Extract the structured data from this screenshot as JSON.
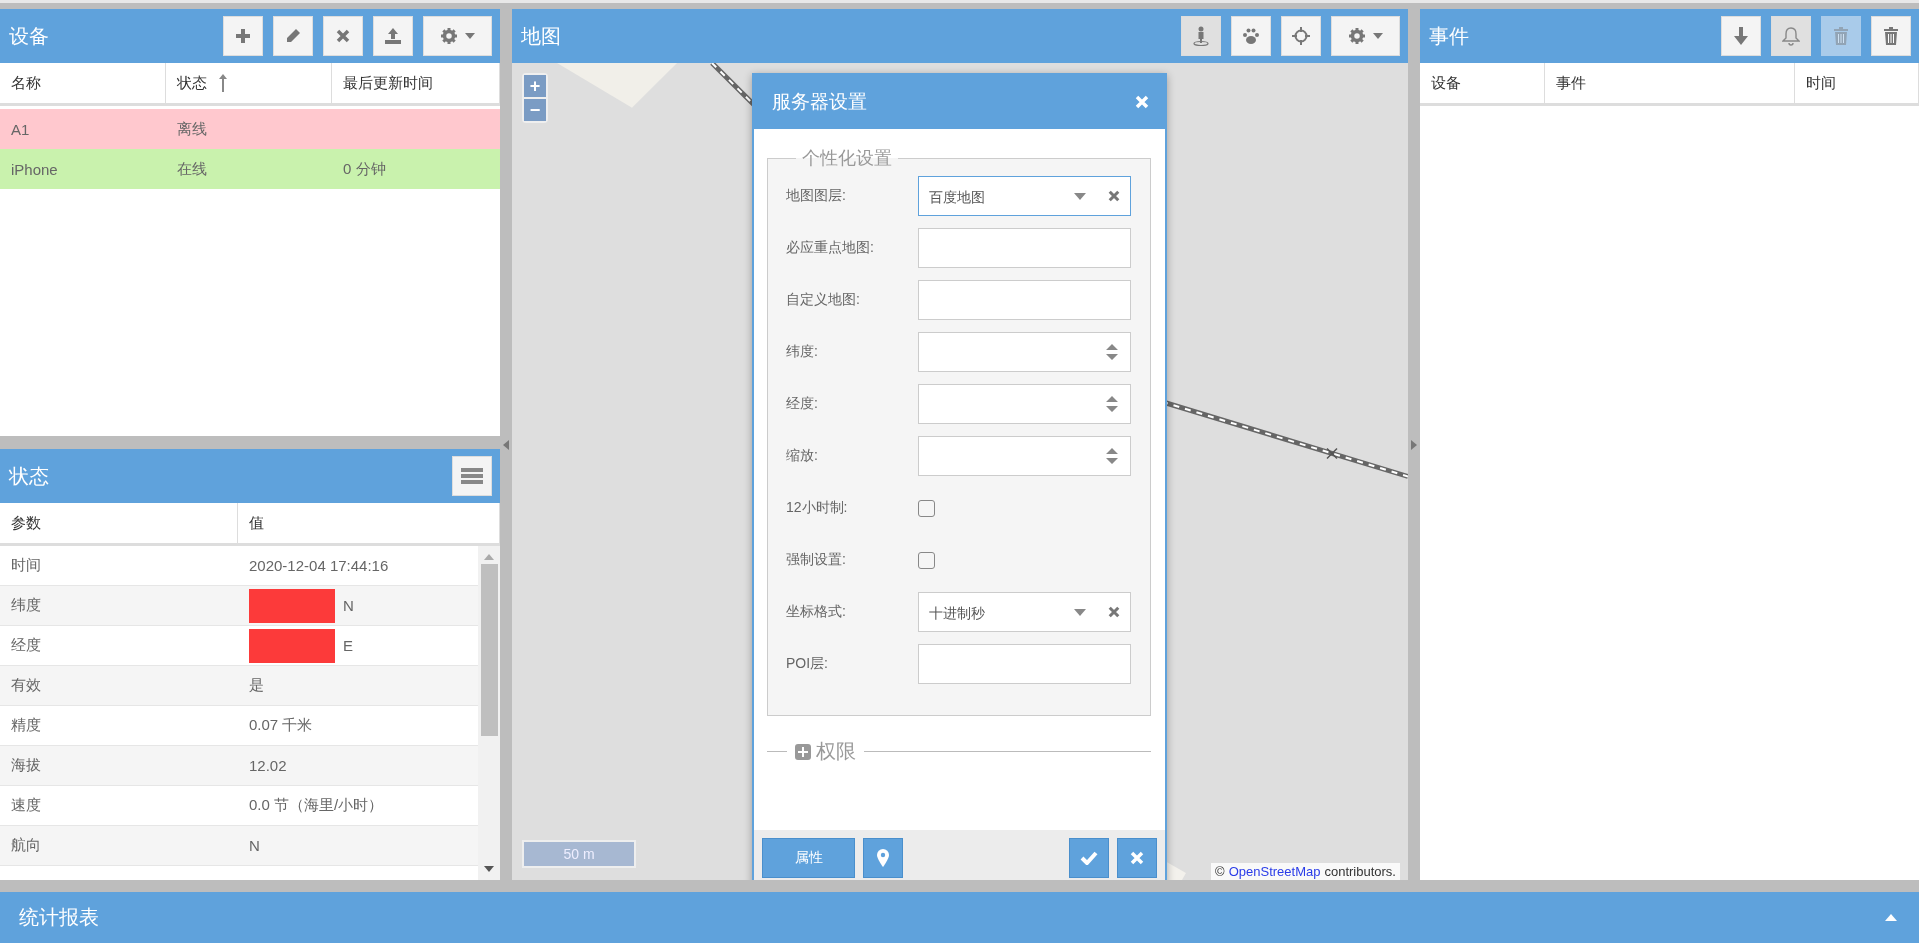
{
  "devices_panel": {
    "title": "设备",
    "columns": [
      {
        "label": "名称",
        "sorted": false
      },
      {
        "label": "状态",
        "sorted": true
      },
      {
        "label": "最后更新时间",
        "sorted": false
      }
    ],
    "rows": [
      {
        "name": "A1",
        "status": "离线",
        "online": false
      },
      {
        "name": "iPhone",
        "status": "在线",
        "last_update": "0 分钟",
        "online": true
      }
    ]
  },
  "status_panel": {
    "title": "状态",
    "columns": [
      "参数",
      "值"
    ],
    "rows": [
      {
        "param": "时间",
        "value": "2020-12-04 17:44:16"
      },
      {
        "param": "纬度",
        "value": "N",
        "redacted": true
      },
      {
        "param": "经度",
        "value": "E",
        "redacted": true
      },
      {
        "param": "有效",
        "value": "是"
      },
      {
        "param": "精度",
        "value": "0.07 千米"
      },
      {
        "param": "海拔",
        "value": "12.02"
      },
      {
        "param": "速度",
        "value": "0.0 节（海里/小时）"
      },
      {
        "param": "航向",
        "value": "N"
      }
    ]
  },
  "map_panel": {
    "title": "地图",
    "toolbar": [
      {
        "on": true
      },
      {
        "on": false
      },
      {
        "on": false
      },
      {
        "on": false
      }
    ],
    "zoom_in": "+",
    "zoom_out": "−",
    "scale": "50 m",
    "attribution": {
      "prefix": "©",
      "link": "OpenStreetMap",
      "suffix": "contributors."
    }
  },
  "dialog": {
    "title": "服务器设置",
    "section": "个性化设置",
    "fields": [
      {
        "kind": "select",
        "label": "地图图层:",
        "value": "百度地图",
        "focused": true
      },
      {
        "kind": "text",
        "label": "必应重点地图:"
      },
      {
        "kind": "text",
        "label": "自定义地图:"
      },
      {
        "kind": "number",
        "label": "纬度:"
      },
      {
        "kind": "number",
        "label": "经度:"
      },
      {
        "kind": "number",
        "label": "缩放:"
      },
      {
        "kind": "checkbox",
        "label": "12小时制:",
        "checked": false
      },
      {
        "kind": "checkbox",
        "label": "强制设置:",
        "checked": false
      },
      {
        "kind": "select",
        "label": "坐标格式:",
        "value": "十进制秒",
        "focused": false
      },
      {
        "kind": "text",
        "label": "POI层:"
      }
    ],
    "collapsed_section": {
      "label": "权限",
      "expanded": false
    },
    "attributes_button": "属性"
  },
  "events_panel": {
    "title": "事件",
    "toolbar": [
      {
        "on": false,
        "disabled": false
      },
      {
        "on": true,
        "disabled": false
      },
      {
        "on": false,
        "disabled": true
      },
      {
        "on": false,
        "disabled": false
      }
    ],
    "columns": [
      "设备",
      "事件",
      "时间"
    ]
  },
  "reports_bar": {
    "title": "统计报表",
    "expanded": false
  }
}
